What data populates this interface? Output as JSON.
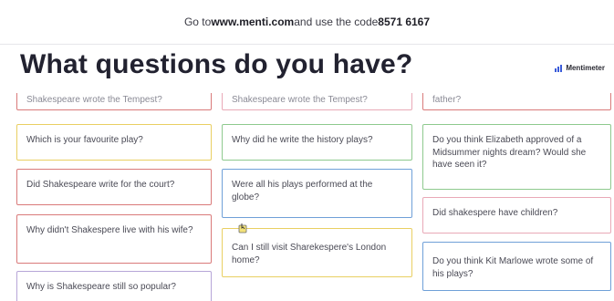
{
  "header": {
    "prefix": "Go to ",
    "url": "www.menti.com",
    "middle": " and use the code ",
    "code": "8571 6167"
  },
  "title": "What questions do you have?",
  "brand": {
    "name": "Mentimeter",
    "icon": "bar-chart-icon",
    "color": "#3a5bd9"
  },
  "colors": {
    "yellow": "#e9cf62",
    "blue": "#6fa0d8",
    "red": "#d97a7a",
    "pink": "#e9a9b7",
    "green": "#8ec98e",
    "purple": "#b7a6d8"
  },
  "columns": [
    {
      "cards": [
        {
          "text": "Shakespeare wrote the Tempest?",
          "color": "red"
        },
        {
          "text": "Which is your favourite play?",
          "color": "yellow"
        },
        {
          "text": "Did Shakespeare write for the court?",
          "color": "red"
        },
        {
          "text": "Why didn't Shakespere live with his wife?",
          "color": "red"
        },
        {
          "text": "Why is Shakespeare still so popular?",
          "color": "purple"
        }
      ]
    },
    {
      "cards": [
        {
          "text": "Shakespeare wrote the Tempest?",
          "color": "pink"
        },
        {
          "text": "Why did he write the history plays?",
          "color": "green"
        },
        {
          "text": "Were all his plays performed at the globe?",
          "color": "blue"
        },
        {
          "text": "Can I still visit Sharekespere's London home?",
          "color": "yellow"
        }
      ]
    },
    {
      "cards": [
        {
          "text": "father?",
          "color": "red"
        },
        {
          "text": "Do you think Elizabeth approved of a Midsummer nights dream? Would she have seen it?",
          "color": "green"
        },
        {
          "text": "Did shakespere have children?",
          "color": "pink"
        },
        {
          "text": "Do you think Kit Marlowe wrote some of his plays?",
          "color": "blue"
        }
      ]
    }
  ]
}
